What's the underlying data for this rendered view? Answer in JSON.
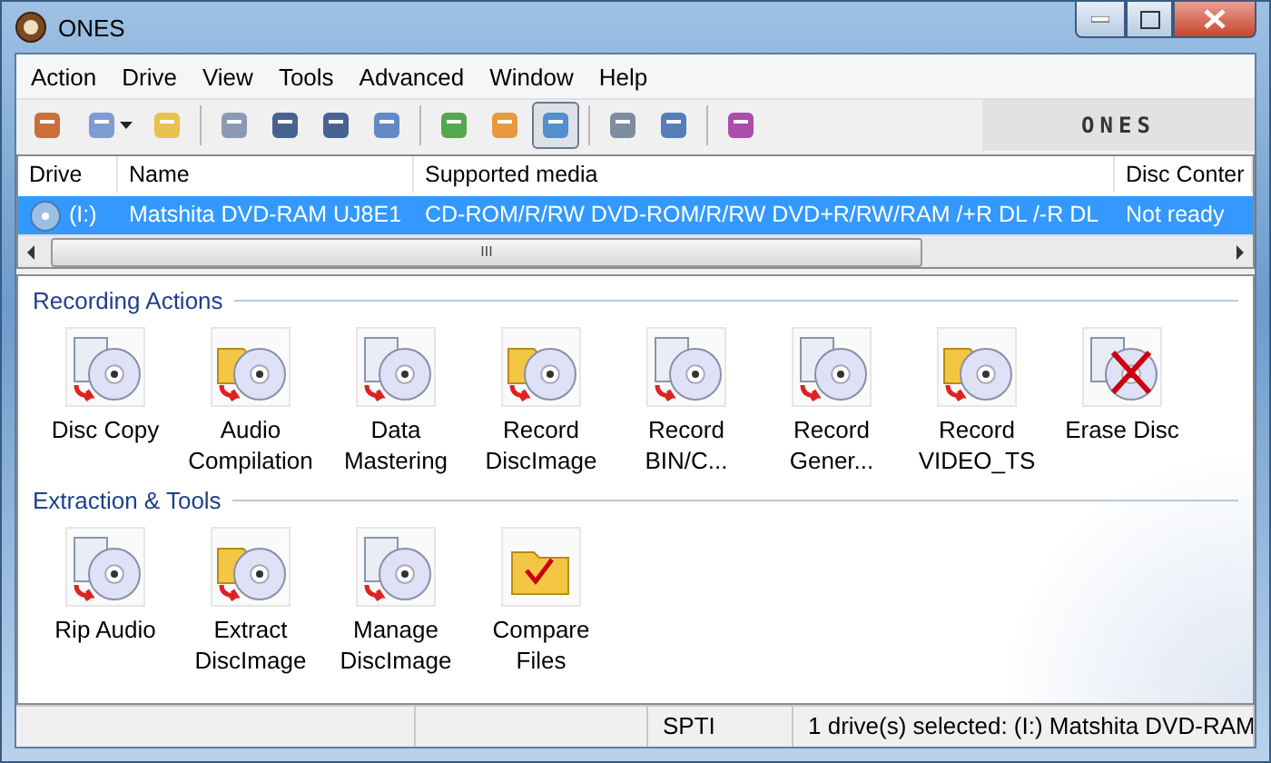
{
  "window": {
    "title": "ONES"
  },
  "menu": [
    "Action",
    "Drive",
    "View",
    "Tools",
    "Advanced",
    "Window",
    "Help"
  ],
  "toolbar": [
    {
      "kind": "button",
      "pressed": false
    },
    {
      "kind": "dropdown",
      "pressed": false
    },
    {
      "kind": "button",
      "pressed": false
    },
    {
      "kind": "separator"
    },
    {
      "kind": "button",
      "pressed": false
    },
    {
      "kind": "button",
      "pressed": false
    },
    {
      "kind": "button",
      "pressed": false
    },
    {
      "kind": "button",
      "pressed": false
    },
    {
      "kind": "separator"
    },
    {
      "kind": "button",
      "pressed": false
    },
    {
      "kind": "button",
      "pressed": false
    },
    {
      "kind": "button",
      "pressed": true
    },
    {
      "kind": "separator"
    },
    {
      "kind": "button",
      "pressed": false
    },
    {
      "kind": "button",
      "pressed": false
    },
    {
      "kind": "separator"
    },
    {
      "kind": "button",
      "pressed": false
    }
  ],
  "brand": "ONES",
  "drive_list": {
    "columns": [
      "Drive",
      "Name",
      "Supported media",
      "Disc Conter"
    ],
    "rows": [
      {
        "selected": true,
        "cells": [
          "(I:)",
          "Matshita DVD-RAM UJ8E1",
          "CD-ROM/R/RW DVD-ROM/R/RW DVD+R/RW/RAM /+R DL /-R DL",
          "Not ready"
        ]
      }
    ],
    "scrollbar_grip": "III"
  },
  "sections": [
    {
      "title": "Recording Actions",
      "actions": [
        {
          "label": "Disc Copy"
        },
        {
          "label": "Audio Compilation"
        },
        {
          "label": "Data Mastering"
        },
        {
          "label": "Record DiscImage"
        },
        {
          "label": "Record BIN/C..."
        },
        {
          "label": "Record Gener..."
        },
        {
          "label": "Record VIDEO_TS"
        },
        {
          "label": "Erase Disc"
        }
      ]
    },
    {
      "title": "Extraction & Tools",
      "actions": [
        {
          "label": "Rip Audio"
        },
        {
          "label": "Extract DiscImage"
        },
        {
          "label": "Manage DiscImage"
        },
        {
          "label": "Compare Files"
        }
      ]
    }
  ],
  "status_bar": [
    "SPTI",
    "1 drive(s) selected: (I:) Matshita DVD-RAM"
  ]
}
